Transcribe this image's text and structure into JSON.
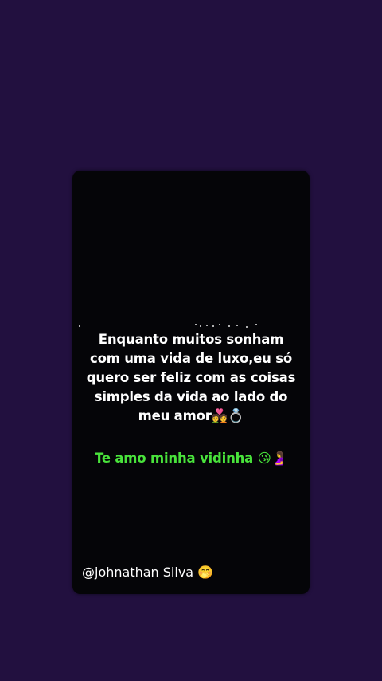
{
  "story": {
    "main_text": "Enquanto muitos sonham com uma vida de luxo,eu só quero ser feliz com as coisas simples da vida ao lado do meu amor",
    "main_emojis": "💑💍",
    "love_text": "Te amo minha vidinha",
    "love_emojis": "😘🤰",
    "handle": "@johnathan Silva",
    "handle_emoji": "🤭"
  },
  "colors": {
    "background": "#22103f",
    "card": "#050508",
    "main_text": "#ffffff",
    "love_text": "#49e33b"
  }
}
